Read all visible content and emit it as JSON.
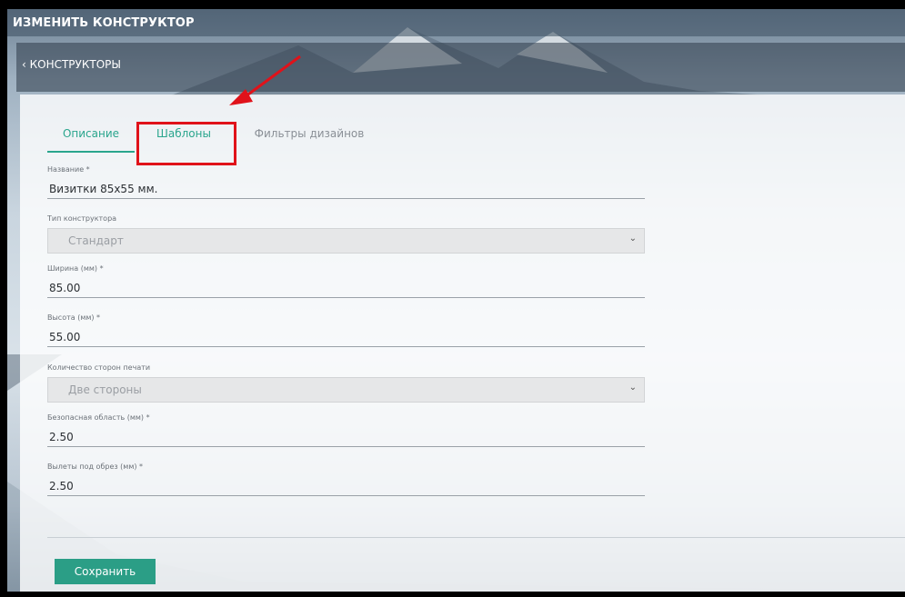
{
  "header": {
    "title": "ИЗМЕНИТЬ КОНСТРУКТОР"
  },
  "breadcrumb": {
    "back_label": "‹ КОНСТРУКТОРЫ"
  },
  "tabs": [
    {
      "label": "Описание",
      "active": true
    },
    {
      "label": "Шаблоны",
      "active": false
    },
    {
      "label": "Фильтры дизайнов",
      "active": false
    }
  ],
  "form": {
    "name": {
      "label": "Название *",
      "value": "Визитки 85x55 мм."
    },
    "type": {
      "label": "Тип конструктора",
      "value": "Стандарт"
    },
    "width": {
      "label": "Ширина (мм) *",
      "value": "85.00"
    },
    "height": {
      "label": "Высота (мм) *",
      "value": "55.00"
    },
    "sides": {
      "label": "Количество сторон печати",
      "value": "Две стороны"
    },
    "safe_area": {
      "label": "Безопасная область (мм) *",
      "value": "2.50"
    },
    "bleed": {
      "label": "Вылеты под обрез (мм) *",
      "value": "2.50"
    }
  },
  "actions": {
    "save_label": "Сохранить"
  },
  "colors": {
    "accent": "#2aa58d",
    "save_button": "#2b9e86",
    "highlight": "#e0121a"
  },
  "icons": {
    "back": "chevron-left-icon",
    "select": "chevron-down-icon"
  }
}
